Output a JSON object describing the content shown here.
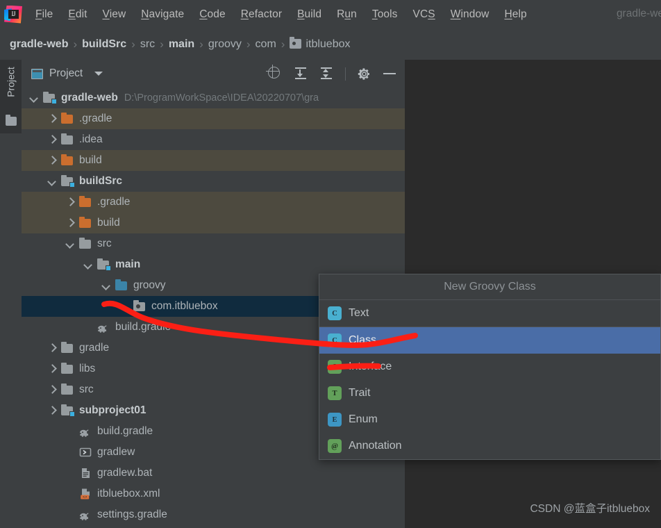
{
  "window": {
    "title": "gradle-we",
    "logo_icon": "intellij-idea-logo",
    "logo_text": "IJ"
  },
  "menubar": {
    "items": [
      {
        "label": "File",
        "mnemonic": "F"
      },
      {
        "label": "Edit",
        "mnemonic": "E"
      },
      {
        "label": "View",
        "mnemonic": "V"
      },
      {
        "label": "Navigate",
        "mnemonic": "N"
      },
      {
        "label": "Code",
        "mnemonic": "C"
      },
      {
        "label": "Refactor",
        "mnemonic": "R"
      },
      {
        "label": "Build",
        "mnemonic": "B"
      },
      {
        "label": "Run",
        "mnemonic": "u"
      },
      {
        "label": "Tools",
        "mnemonic": "T"
      },
      {
        "label": "VCS",
        "mnemonic": "S"
      },
      {
        "label": "Window",
        "mnemonic": "W"
      },
      {
        "label": "Help",
        "mnemonic": "H"
      }
    ]
  },
  "breadcrumb": {
    "separator": "›",
    "items": [
      {
        "label": "gradle-web",
        "bold": true,
        "icon": null
      },
      {
        "label": "buildSrc",
        "bold": true,
        "icon": null
      },
      {
        "label": "src",
        "bold": false,
        "icon": null
      },
      {
        "label": "main",
        "bold": true,
        "icon": null
      },
      {
        "label": "groovy",
        "bold": false,
        "icon": null
      },
      {
        "label": "com",
        "bold": false,
        "icon": null
      },
      {
        "label": "itbluebox",
        "bold": false,
        "icon": "package-folder-icon"
      }
    ]
  },
  "toolstrip": {
    "tab_label": "Project",
    "folder_icon": "folder-icon"
  },
  "project_panel": {
    "title": "Project",
    "view_icon": "project-view-icon",
    "dropdown_icon": "chevron-down-icon",
    "actions": [
      {
        "name": "locate-file-icon",
        "tooltip": "Select Opened File"
      },
      {
        "name": "expand-all-icon",
        "tooltip": "Expand All"
      },
      {
        "name": "collapse-all-icon",
        "tooltip": "Collapse All"
      },
      {
        "name": "gear-icon",
        "tooltip": "Settings"
      },
      {
        "name": "minimize-icon",
        "tooltip": "Hide"
      }
    ],
    "tree": [
      {
        "label": "gradle-web",
        "path": "D:\\ProgramWorkSpace\\IDEA\\20220707\\gra",
        "indent": 0,
        "arrow": "down",
        "icon": "module-folder-icon",
        "bold": true,
        "row": "normal"
      },
      {
        "label": ".gradle",
        "path": "",
        "indent": 1,
        "arrow": "right",
        "icon": "folder-orange-icon",
        "bold": false,
        "row": "brown"
      },
      {
        "label": ".idea",
        "path": "",
        "indent": 1,
        "arrow": "right",
        "icon": "folder-gray-icon",
        "bold": false,
        "row": "normal"
      },
      {
        "label": "build",
        "path": "",
        "indent": 1,
        "arrow": "right",
        "icon": "folder-orange-icon",
        "bold": false,
        "row": "brown"
      },
      {
        "label": "buildSrc",
        "path": "",
        "indent": 1,
        "arrow": "down",
        "icon": "module-folder-icon",
        "bold": true,
        "row": "normal"
      },
      {
        "label": ".gradle",
        "path": "",
        "indent": 2,
        "arrow": "right",
        "icon": "folder-orange-icon",
        "bold": false,
        "row": "brown"
      },
      {
        "label": "build",
        "path": "",
        "indent": 2,
        "arrow": "right",
        "icon": "folder-orange-icon",
        "bold": false,
        "row": "brown"
      },
      {
        "label": "src",
        "path": "",
        "indent": 2,
        "arrow": "down",
        "icon": "folder-gray-icon",
        "bold": false,
        "row": "normal"
      },
      {
        "label": "main",
        "path": "",
        "indent": 3,
        "arrow": "down",
        "icon": "module-folder-icon",
        "bold": true,
        "row": "normal"
      },
      {
        "label": "groovy",
        "path": "",
        "indent": 4,
        "arrow": "down",
        "icon": "folder-blue-icon",
        "bold": false,
        "row": "normal"
      },
      {
        "label": "com.itbluebox",
        "path": "",
        "indent": 5,
        "arrow": "none",
        "icon": "package-icon",
        "bold": false,
        "row": "selected"
      },
      {
        "label": "build.gradle",
        "path": "",
        "indent": 3,
        "arrow": "none",
        "icon": "gradle-file-icon",
        "bold": false,
        "row": "normal"
      },
      {
        "label": "gradle",
        "path": "",
        "indent": 1,
        "arrow": "right",
        "icon": "folder-gray-icon",
        "bold": false,
        "row": "normal"
      },
      {
        "label": "libs",
        "path": "",
        "indent": 1,
        "arrow": "right",
        "icon": "folder-gray-icon",
        "bold": false,
        "row": "normal"
      },
      {
        "label": "src",
        "path": "",
        "indent": 1,
        "arrow": "right",
        "icon": "folder-gray-icon",
        "bold": false,
        "row": "normal"
      },
      {
        "label": "subproject01",
        "path": "",
        "indent": 1,
        "arrow": "right",
        "icon": "module-folder-icon",
        "bold": true,
        "row": "normal"
      },
      {
        "label": "build.gradle",
        "path": "",
        "indent": 2,
        "arrow": "none",
        "icon": "gradle-file-icon",
        "bold": false,
        "row": "normal"
      },
      {
        "label": "gradlew",
        "path": "",
        "indent": 2,
        "arrow": "none",
        "icon": "shell-script-icon",
        "bold": false,
        "row": "normal"
      },
      {
        "label": "gradlew.bat",
        "path": "",
        "indent": 2,
        "arrow": "none",
        "icon": "bat-file-icon",
        "bold": false,
        "row": "normal"
      },
      {
        "label": "itbluebox.xml",
        "path": "",
        "indent": 2,
        "arrow": "none",
        "icon": "xml-file-icon",
        "bold": false,
        "row": "normal"
      },
      {
        "label": "settings.gradle",
        "path": "",
        "indent": 2,
        "arrow": "none",
        "icon": "gradle-file-icon",
        "bold": false,
        "row": "normal"
      }
    ]
  },
  "popup": {
    "title": "New Groovy Class",
    "items": [
      {
        "label": "Text",
        "badge": "C",
        "badge_color": "teal",
        "selected": false,
        "icon": "groovy-class-icon"
      },
      {
        "label": "Class",
        "badge": "C",
        "badge_color": "teal",
        "selected": true,
        "icon": "groovy-class-icon"
      },
      {
        "label": "Interface",
        "badge": "I",
        "badge_color": "green",
        "selected": false,
        "icon": "groovy-interface-icon"
      },
      {
        "label": "Trait",
        "badge": "T",
        "badge_color": "green",
        "selected": false,
        "icon": "groovy-trait-icon"
      },
      {
        "label": "Enum",
        "badge": "E",
        "badge_color": "blue",
        "selected": false,
        "icon": "groovy-enum-icon"
      },
      {
        "label": "Annotation",
        "badge": "@",
        "badge_color": "green",
        "selected": false,
        "icon": "groovy-annotation-icon"
      }
    ]
  },
  "watermark": {
    "text": "CSDN @蓝盒子itbluebox"
  },
  "colors": {
    "background": "#3c3f41",
    "editor_background": "#2b2b2b",
    "row_highlight_brown": "#4d4a3f",
    "row_selected_navy": "#102b3e",
    "popup_selection_blue": "#4a6da7",
    "annotation_red": "#fb1f15",
    "folder_orange": "#cb6e2e",
    "folder_gray": "#969c9f",
    "folder_blue": "#3b84a8"
  }
}
